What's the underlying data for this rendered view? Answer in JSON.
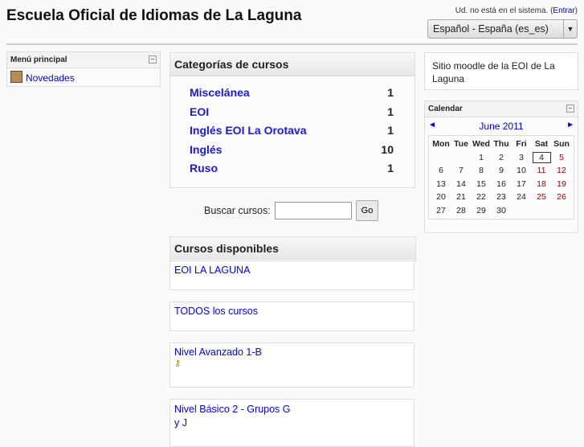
{
  "header": {
    "title": "Escuela Oficial de Idiomas de La Laguna",
    "login_text": "Ud. no está en el sistema. (",
    "login_link": "Entrar",
    "login_close": ")",
    "language": "Español - España (es_es)"
  },
  "menu": {
    "title": "Menú principal",
    "items": [
      {
        "label": "Novedades"
      }
    ]
  },
  "categories": {
    "title": "Categorías de cursos",
    "items": [
      {
        "name": "Miscelánea",
        "count": "1"
      },
      {
        "name": "EOI",
        "count": "1"
      },
      {
        "name": "Inglés EOI La Orotava",
        "count": "1"
      },
      {
        "name": "Inglés",
        "count": "10"
      },
      {
        "name": "Ruso",
        "count": "1"
      }
    ]
  },
  "search": {
    "label": "Buscar cursos:",
    "value": "",
    "button": "Go"
  },
  "courses": {
    "title": "Cursos disponibles",
    "items": [
      "EOI LA LAGUNA",
      "TODOS los cursos",
      "Nivel Avanzado 1-B",
      "Nivel Básico 2 - Grupos G y J"
    ]
  },
  "site": {
    "description": "Sitio moodle de la EOI de La Laguna"
  },
  "calendar": {
    "title": "Calendar",
    "month": "June 2011",
    "prev": "◄",
    "next": "►",
    "days": [
      "Mon",
      "Tue",
      "Wed",
      "Thu",
      "Fri",
      "Sat",
      "Sun"
    ],
    "today": "4",
    "weeks": [
      [
        "",
        "",
        "1",
        "2",
        "3",
        "4",
        "5"
      ],
      [
        "6",
        "7",
        "8",
        "9",
        "10",
        "11",
        "12"
      ],
      [
        "13",
        "14",
        "15",
        "16",
        "17",
        "18",
        "19"
      ],
      [
        "20",
        "21",
        "22",
        "23",
        "24",
        "25",
        "26"
      ],
      [
        "27",
        "28",
        "29",
        "30",
        "",
        "",
        ""
      ]
    ]
  }
}
